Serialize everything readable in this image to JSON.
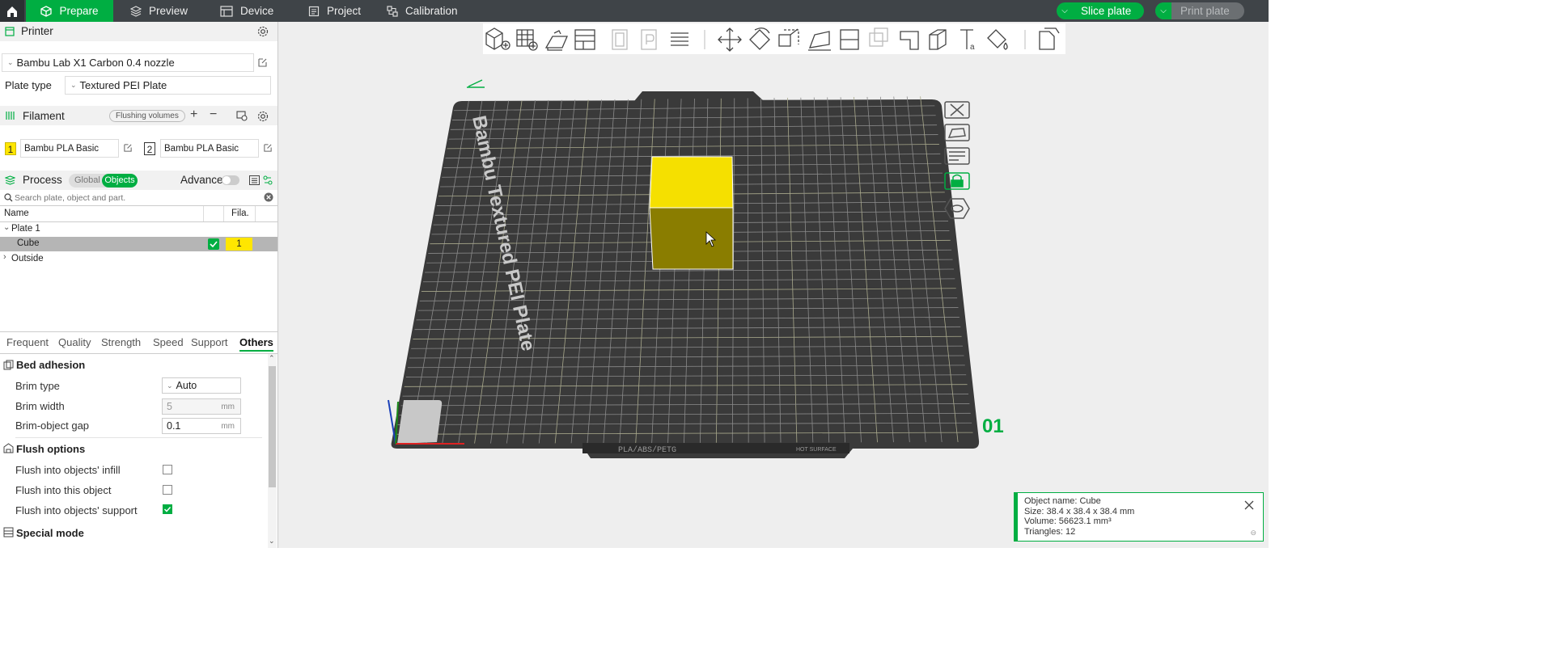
{
  "topbar": {
    "tabs": [
      {
        "label": "Prepare",
        "icon": "cube-icon"
      },
      {
        "label": "Preview",
        "icon": "layers-icon"
      },
      {
        "label": "Device",
        "icon": "printer-icon"
      },
      {
        "label": "Project",
        "icon": "document-icon"
      },
      {
        "label": "Calibration",
        "icon": "calibration-icon"
      }
    ],
    "slice_label": "Slice plate",
    "print_label": "Print plate"
  },
  "printer": {
    "title": "Printer",
    "model": "Bambu Lab X1 Carbon 0.4 nozzle",
    "plate_type_label": "Plate type",
    "plate_type_value": "Textured PEI Plate"
  },
  "filament": {
    "title": "Filament",
    "flushing_label": "Flushing volumes",
    "slots": [
      {
        "num": "1",
        "name": "Bambu PLA Basic",
        "color": "#ffe600"
      },
      {
        "num": "2",
        "name": "Bambu PLA Basic",
        "color": "#ffffff"
      }
    ]
  },
  "process": {
    "title": "Process",
    "global_label": "Global",
    "objects_label": "Objects",
    "advance_label": "Advance"
  },
  "search": {
    "placeholder": "Search plate, object and part."
  },
  "object_list": {
    "col_name": "Name",
    "col_fila": "Fila.",
    "plate": "Plate 1",
    "object": "Cube",
    "object_fila": "1",
    "outside": "Outside"
  },
  "settings_tabs": [
    "Frequent",
    "Quality",
    "Strength",
    "Speed",
    "Support",
    "Others"
  ],
  "settings": {
    "bed_adhesion_title": "Bed adhesion",
    "brim_type_label": "Brim type",
    "brim_type_value": "Auto",
    "brim_width_label": "Brim width",
    "brim_width_value": "5",
    "brim_gap_label": "Brim-object gap",
    "brim_gap_value": "0.1",
    "unit_mm": "mm",
    "flush_title": "Flush options",
    "flush_infill_label": "Flush into objects' infill",
    "flush_object_label": "Flush into this object",
    "flush_support_label": "Flush into objects' support",
    "flush_infill": false,
    "flush_object": false,
    "flush_support": true,
    "special_title": "Special mode"
  },
  "plate_view": {
    "plate_name_text": "Bambu Textured PEI Plate",
    "plate_number": "01",
    "bed_strip_text": "PLA/ABS/PETG",
    "hot_surface_text": "HOT SURFACE",
    "cube_color": "#f5e000"
  },
  "info_panel": {
    "object_name": "Object name: Cube",
    "size": "Size: 38.4 x 38.4 x 38.4 mm",
    "volume": "Volume: 56623.1 mm³",
    "triangles": "Triangles: 12"
  },
  "colors": {
    "accent": "#00ae42",
    "topbar": "#3f4448"
  }
}
